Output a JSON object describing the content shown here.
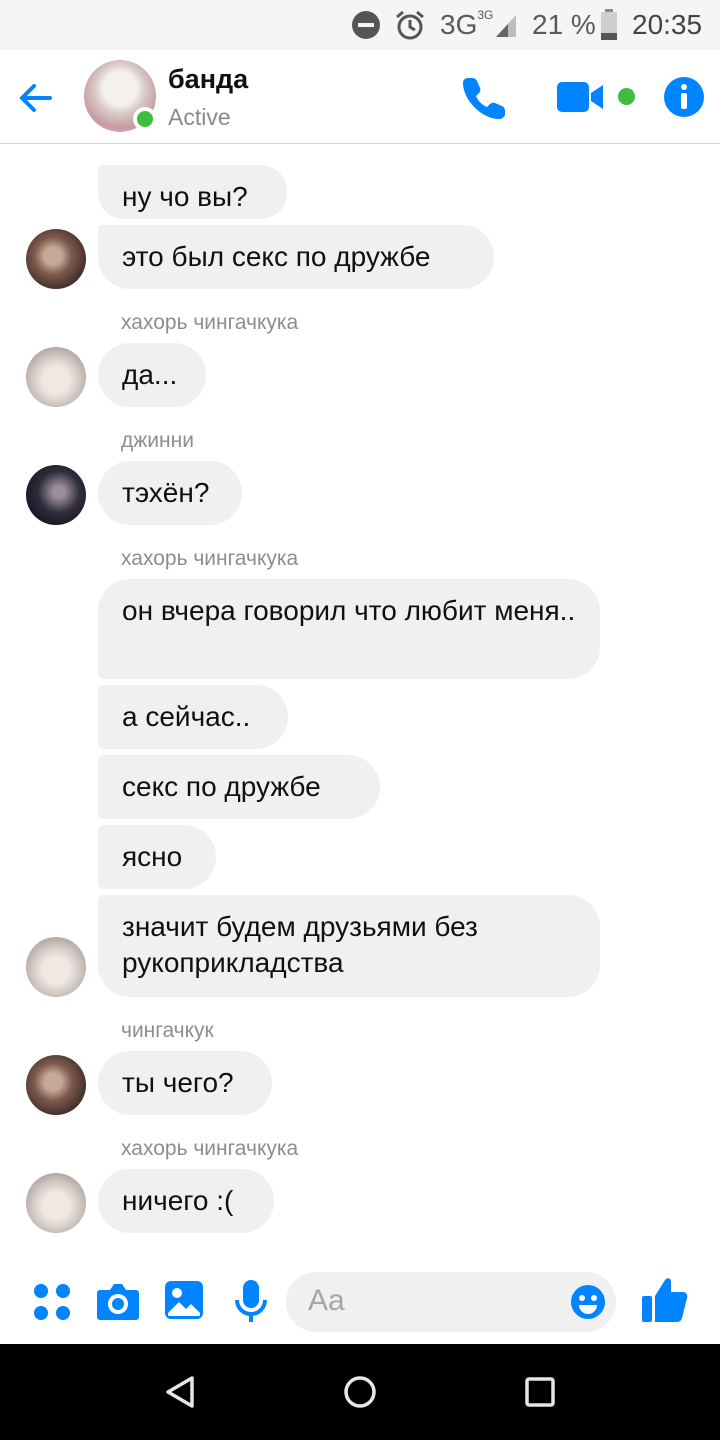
{
  "status_bar": {
    "network": "3G",
    "network_small": "3G",
    "battery_percent": "21 %",
    "time": "20:35"
  },
  "header": {
    "title": "банда",
    "status": "Active"
  },
  "messages": [
    {
      "text": "ну чо вы?"
    },
    {
      "text": "это был секс по дружбе"
    },
    {
      "sender": "хахорь чингачкука",
      "text": "да..."
    },
    {
      "sender": "джинни",
      "text": "тэхён?"
    },
    {
      "sender": "хахорь чингачкука",
      "text": "он вчера говорил что любит меня.."
    },
    {
      "text": "а сейчас.."
    },
    {
      "text": "секс по дружбе"
    },
    {
      "text": "ясно"
    },
    {
      "text": "значит будем друзьями без рукоприкладства"
    },
    {
      "sender": "чингачкук",
      "text": "ты чего?"
    },
    {
      "sender": "хахорь чингачкука",
      "text": "ничего :("
    }
  ],
  "composer": {
    "placeholder": "Aa"
  },
  "colors": {
    "accent": "#0084ff",
    "active_green": "#3fbd3f",
    "bubble": "#f1f0f0"
  }
}
